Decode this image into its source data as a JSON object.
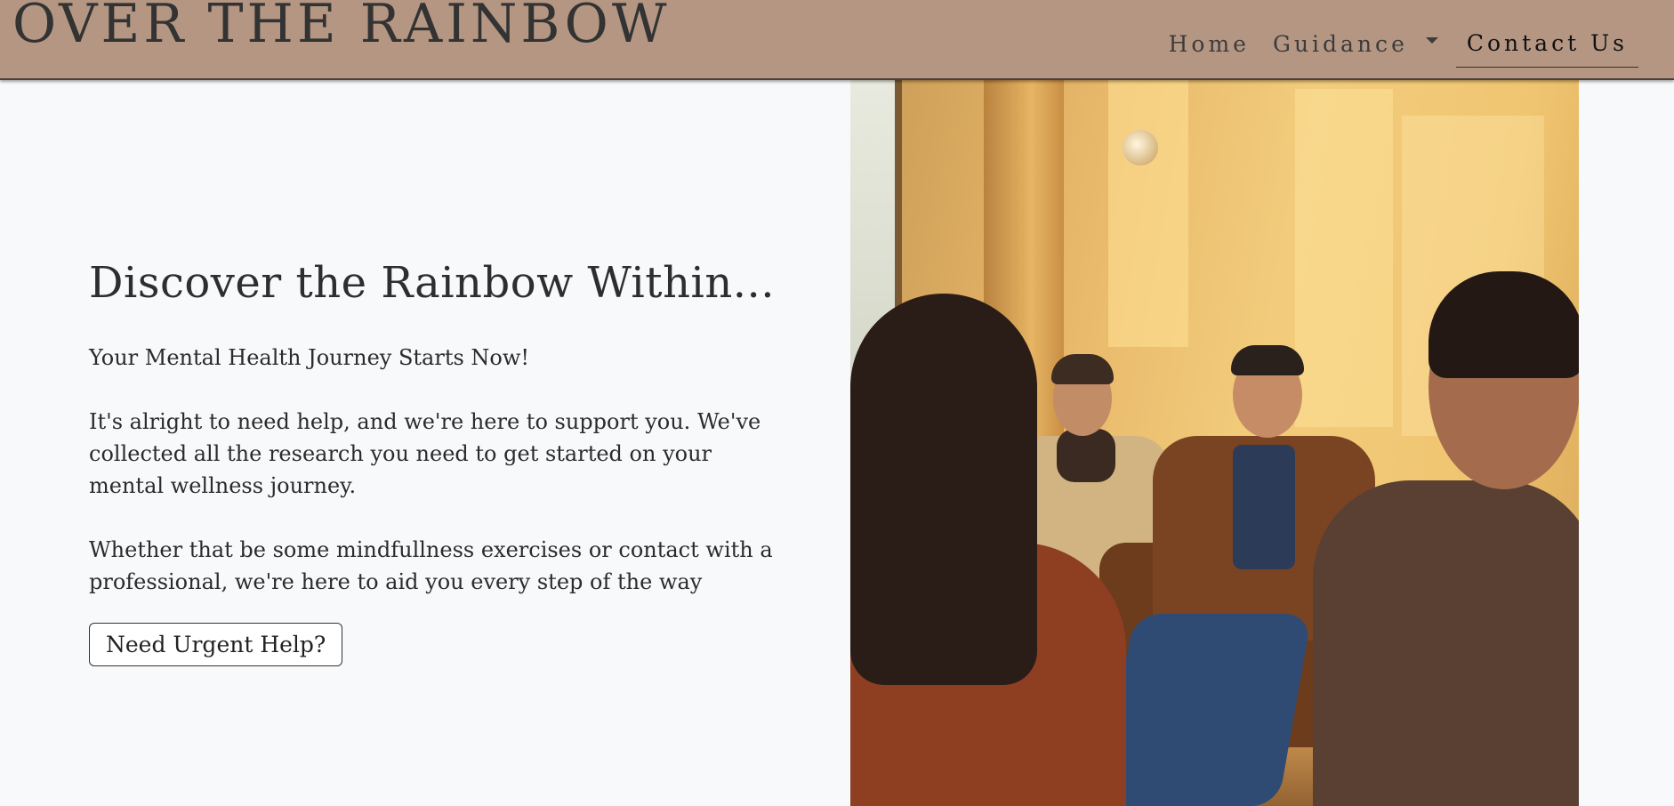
{
  "header": {
    "brand": "OVER THE RAINBOW",
    "nav": {
      "home": "Home",
      "guidance": "Guidance",
      "contact": "Contact Us"
    },
    "colors": {
      "background": "#b49683",
      "text": "#333333"
    }
  },
  "hero": {
    "title": "Discover the Rainbow Within...",
    "subtitle": "Your Mental Health Journey Starts Now!",
    "paragraph1": "It's alright to need help, and we're here to support you. We've collected all the research you need to get started on your mental wellness journey.",
    "paragraph2": "Whether that be some mindfullness exercises or contact with a professional, we're here to aid you every step of the way",
    "button_label": "Need Urgent Help?"
  },
  "icons": {
    "dropdown": "caret-down-icon"
  }
}
